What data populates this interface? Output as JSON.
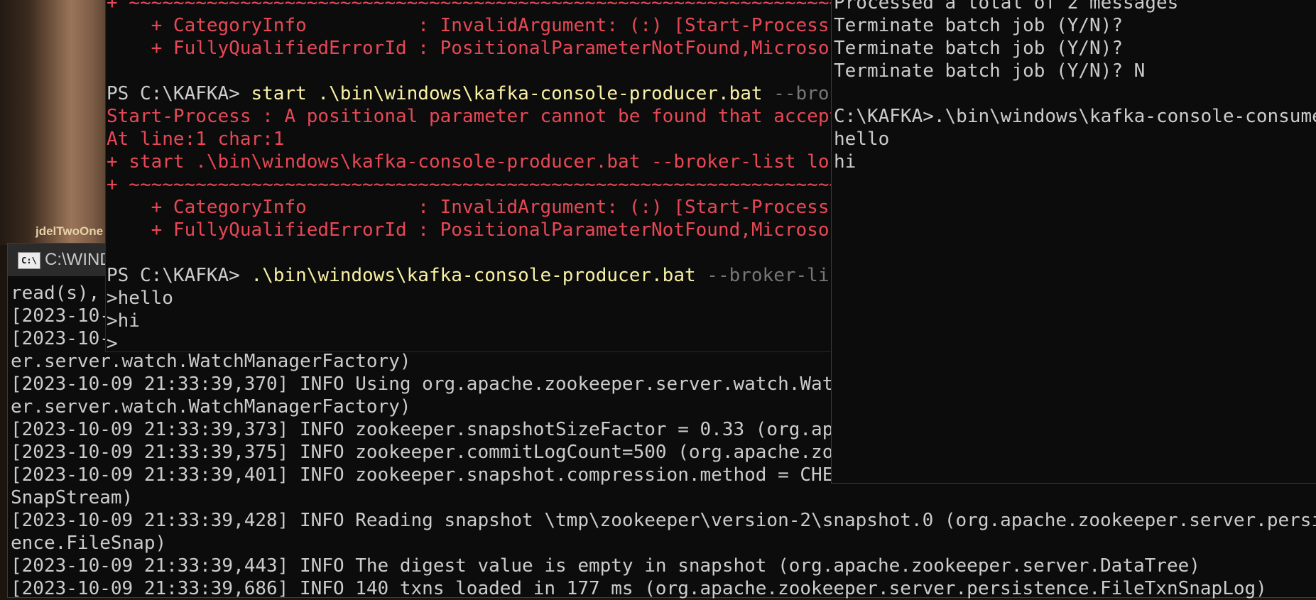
{
  "wallpaper": {
    "caption": "jdelTwoOne"
  },
  "cmd_window": {
    "title": "C:\\WIND",
    "icon": "cmd-icon",
    "lines": [
      "read(s),",
      "[2023-10-",
      "[2023-10-",
      "er.server.watch.WatchManagerFactory)",
      "[2023-10-09 21:33:39,370] INFO Using org.apache.zookeeper.server.watch.WatchMa",
      "er.server.watch.WatchManagerFactory)",
      "[2023-10-09 21:33:39,373] INFO zookeeper.snapshotSizeFactor = 0.33 (org.apache",
      "[2023-10-09 21:33:39,375] INFO zookeeper.commitLogCount=500 (org.apache.zookee",
      "[2023-10-09 21:33:39,401] INFO zookeeper.snapshot.compression.method = CHECKED",
      "SnapStream)",
      "[2023-10-09 21:33:39,428] INFO Reading snapshot \\tmp\\zookeeper\\version-2\\snapshot.0 (org.apache.zookeeper.server.persist",
      "ence.FileSnap)",
      "[2023-10-09 21:33:39,443] INFO The digest value is empty in snapshot (org.apache.zookeeper.server.DataTree)",
      "[2023-10-09 21:33:39,686] INFO 140 txns loaded in 177 ms (org.apache.zookeeper.server.persistence.FileTxnSnapLog)"
    ]
  },
  "ps_window": {
    "lines": [
      {
        "text": "+ ~~~~~~~~~~~~~~~~~~~~~~~~~~~~~~~~~~~~~~~~~~~~~~~~~~~~~~~~~~~~~~~~~~~",
        "cls": "err"
      },
      {
        "text": "    + CategoryInfo          : InvalidArgument: (:) [Start-Process],",
        "cls": "err"
      },
      {
        "text": "    + FullyQualifiedErrorId : PositionalParameterNotFound,Microsoft.",
        "cls": "err"
      },
      {
        "text": "",
        "cls": "err"
      },
      {
        "segments": [
          {
            "text": "PS C:\\KAFKA> ",
            "cls": "ps-text"
          },
          {
            "text": "start .\\bin\\windows\\kafka-console-producer.bat ",
            "cls": "cmd"
          },
          {
            "text": "--broker",
            "cls": "param"
          }
        ]
      },
      {
        "text": "Start-Process : A positional parameter cannot be found that accepts",
        "cls": "err"
      },
      {
        "text": "At line:1 char:1",
        "cls": "err"
      },
      {
        "text": "+ start .\\bin\\windows\\kafka-console-producer.bat --broker-list local",
        "cls": "err"
      },
      {
        "text": "+ ~~~~~~~~~~~~~~~~~~~~~~~~~~~~~~~~~~~~~~~~~~~~~~~~~~~~~~~~~~~~~~~~~~~",
        "cls": "err"
      },
      {
        "text": "    + CategoryInfo          : InvalidArgument: (:) [Start-Process],",
        "cls": "err"
      },
      {
        "text": "    + FullyQualifiedErrorId : PositionalParameterNotFound,Microsoft.",
        "cls": "err"
      },
      {
        "text": "",
        "cls": "err"
      },
      {
        "segments": [
          {
            "text": "PS C:\\KAFKA> ",
            "cls": "ps-text"
          },
          {
            "text": ".\\bin\\windows\\kafka-console-producer.bat ",
            "cls": "cmd"
          },
          {
            "text": "--broker-list ",
            "cls": "param"
          }
        ]
      },
      {
        "text": ">hello",
        "cls": "ps-text"
      },
      {
        "text": ">hi",
        "cls": "ps-text"
      },
      {
        "text": ">",
        "cls": "ps-text"
      }
    ]
  },
  "consumer_window": {
    "lines": [
      "Processed a total of 2 messages",
      "Terminate batch job (Y/N)?",
      "Terminate batch job (Y/N)?",
      "Terminate batch job (Y/N)? N",
      "",
      "C:\\KAFKA>.\\bin\\windows\\kafka-console-consumer",
      "hello",
      "hi"
    ]
  }
}
